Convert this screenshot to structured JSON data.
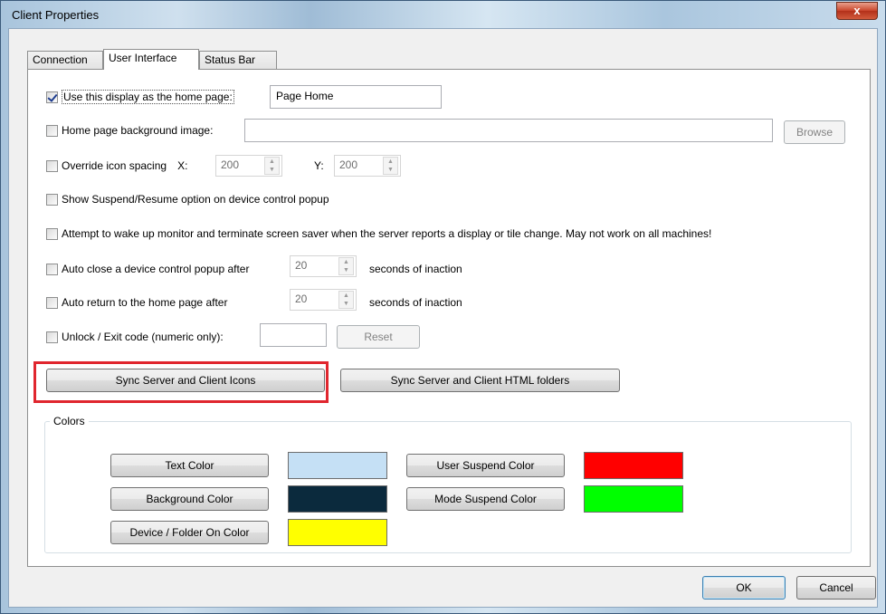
{
  "window": {
    "title": "Client Properties",
    "close_glyph": "x"
  },
  "tabs": [
    {
      "label": "Connection",
      "active": false
    },
    {
      "label": "User Interface",
      "active": true
    },
    {
      "label": "Status Bar",
      "active": false
    }
  ],
  "options": {
    "home_page": {
      "label": "Use this display as the home page:",
      "checked": true,
      "value": "Page Home"
    },
    "background_image": {
      "label": "Home page background image:",
      "checked": false,
      "value": "",
      "browse_label": "Browse"
    },
    "icon_spacing": {
      "label": "Override icon spacing",
      "checked": false,
      "x_label": "X:",
      "x_value": "200",
      "y_label": "Y:",
      "y_value": "200"
    },
    "suspend_resume": {
      "label": "Show Suspend/Resume option on device control popup",
      "checked": false
    },
    "wake_monitor": {
      "label": "Attempt to wake up monitor and terminate screen saver when the server reports a display or tile change.  May not work on all machines!",
      "checked": false
    },
    "auto_close": {
      "label": "Auto close a device control popup after",
      "checked": false,
      "value": "20",
      "suffix": "seconds of inaction"
    },
    "auto_return": {
      "label": "Auto return to the home page after",
      "checked": false,
      "value": "20",
      "suffix": "seconds of inaction"
    },
    "unlock": {
      "label": "Unlock / Exit code (numeric only):",
      "checked": false,
      "value": "",
      "reset_label": "Reset"
    }
  },
  "sync": {
    "icons_label": "Sync Server and Client Icons",
    "html_label": "Sync Server and Client HTML folders"
  },
  "colors": {
    "title": "Colors",
    "text_color": {
      "label": "Text Color",
      "swatch": "#c5e0f5"
    },
    "background_color": {
      "label": "Background Color",
      "swatch": "#0b2a3d"
    },
    "device_on_color": {
      "label": "Device / Folder On Color",
      "swatch": "#ffff00"
    },
    "user_suspend_color": {
      "label": "User Suspend Color",
      "swatch": "#ff0000"
    },
    "mode_suspend_color": {
      "label": "Mode Suspend Color",
      "swatch": "#00ff00"
    }
  },
  "footer": {
    "ok_label": "OK",
    "cancel_label": "Cancel"
  },
  "accent": {
    "highlight": "#e0262e"
  }
}
